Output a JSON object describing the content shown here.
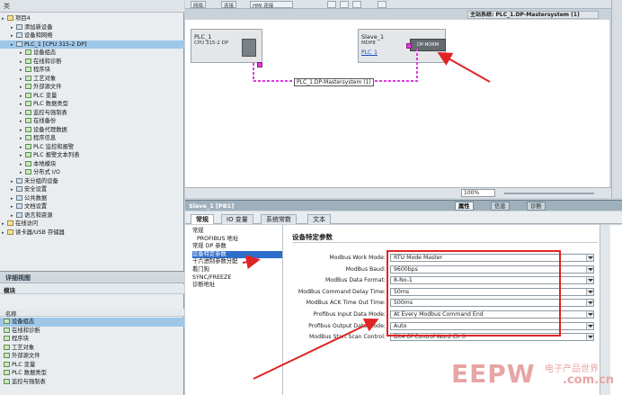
{
  "tree": {
    "header": "类",
    "items": [
      {
        "label": "项目4",
        "level": 0,
        "icon": "project-icon"
      },
      {
        "label": "添加新设备",
        "level": 1,
        "icon": "add-device-icon"
      },
      {
        "label": "设备和网络",
        "level": 1,
        "icon": "network-icon"
      },
      {
        "label": "PLC_1 [CPU 315-2 DP]",
        "level": 1,
        "icon": "plc-icon",
        "selected": true
      },
      {
        "label": "设备组态",
        "level": 2,
        "icon": "device-config-icon"
      },
      {
        "label": "在线和诊断",
        "level": 2,
        "icon": "online-diagnostics-icon"
      },
      {
        "label": "程序块",
        "level": 2,
        "icon": "program-blocks-icon"
      },
      {
        "label": "工艺对象",
        "level": 2,
        "icon": "technology-objects-icon"
      },
      {
        "label": "外部源文件",
        "level": 2,
        "icon": "external-source-icon"
      },
      {
        "label": "PLC 变量",
        "level": 2,
        "icon": "plc-tags-icon"
      },
      {
        "label": "PLC 数据类型",
        "level": 2,
        "icon": "plc-datatypes-icon"
      },
      {
        "label": "监控与强制表",
        "level": 2,
        "icon": "watch-table-icon"
      },
      {
        "label": "在线备份",
        "level": 2,
        "icon": "online-backup-icon"
      },
      {
        "label": "设备代理数据",
        "level": 2,
        "icon": "device-proxy-icon"
      },
      {
        "label": "程序信息",
        "level": 2,
        "icon": "program-info-icon"
      },
      {
        "label": "PLC 监控和报警",
        "level": 2,
        "icon": "plc-alarm-icon"
      },
      {
        "label": "PLC 报警文本列表",
        "level": 2,
        "icon": "alarm-text-icon"
      },
      {
        "label": "本地模块",
        "level": 2,
        "icon": "local-modules-icon"
      },
      {
        "label": "分布式 I/O",
        "level": 2,
        "icon": "distributed-io-icon"
      },
      {
        "label": "未分组的设备",
        "level": 1,
        "icon": "ungrouped-devices-icon"
      },
      {
        "label": "安全设置",
        "level": 1,
        "icon": "security-settings-icon"
      },
      {
        "label": "公共数据",
        "level": 1,
        "icon": "common-data-icon"
      },
      {
        "label": "文档设置",
        "level": 1,
        "icon": "document-settings-icon"
      },
      {
        "label": "语言和资源",
        "level": 1,
        "icon": "languages-icon"
      },
      {
        "label": "在线访问",
        "level": 0,
        "icon": "online-access-icon"
      },
      {
        "label": "读卡器/USB 存储器",
        "level": 0,
        "icon": "card-reader-icon"
      }
    ]
  },
  "detail": {
    "title": "详细视图",
    "subtitle": "模块",
    "column": "名称",
    "items": [
      {
        "label": "设备组态",
        "selected": true
      },
      {
        "label": "在线和诊断"
      },
      {
        "label": "程序块"
      },
      {
        "label": "工艺对象"
      },
      {
        "label": "外部源文件"
      },
      {
        "label": "PLC 变量"
      },
      {
        "label": "PLC 数据类型"
      },
      {
        "label": "监控与强制表"
      }
    ]
  },
  "network": {
    "toolbar": {
      "network_btn": "网络",
      "connect_btn": "连接",
      "hmi_conn": "HMI 连接"
    },
    "master_system": "主站系统: PLC_1.DP-Mastersystem (1)",
    "plc": {
      "name": "PLC_1",
      "type": "CPU 315-2 DP"
    },
    "slave": {
      "name": "Slave_1",
      "type": "MDP8",
      "link": "PLC_1",
      "module": "DP-NORM"
    },
    "bus_label": "PLC_1.DP-Mastersystem (1)",
    "zoom": "100%"
  },
  "properties": {
    "object": "Slave_1 [PB1]",
    "tabs": [
      "属性",
      "信息",
      "诊断"
    ],
    "sub_tabs": [
      "常规",
      "IO 变量",
      "系统常数",
      "文本"
    ],
    "nav": [
      {
        "label": "常规",
        "indent": false
      },
      {
        "label": "PROFIBUS 地址",
        "indent": true
      },
      {
        "label": "常规 DP 参数",
        "indent": false
      },
      {
        "label": "设备特定参数",
        "indent": false,
        "selected": true
      },
      {
        "label": "十六进制参数分配",
        "indent": false
      },
      {
        "label": "看门狗",
        "indent": false
      },
      {
        "label": "SYNC/FREEZE",
        "indent": false
      },
      {
        "label": "诊断地址",
        "indent": false
      }
    ],
    "section_title": "设备特定参数",
    "params": [
      {
        "label": "Modbus Work Mode:",
        "value": "RTU Mode Master"
      },
      {
        "label": "ModBus Baud:",
        "value": "9600bps"
      },
      {
        "label": "ModBus Data Format:",
        "value": "8-No-1"
      },
      {
        "label": "ModBus Command Delay Time:",
        "value": "50ms"
      },
      {
        "label": "ModBus ACK Time Out Time:",
        "value": "500ms"
      },
      {
        "label": "Profibus Input Data Mode:",
        "value": "At Every Modbus Command End"
      },
      {
        "label": "Profibus Output Data Mode:",
        "value": "Auto"
      },
      {
        "label": "ModBus Start Scan Control:",
        "value": "Bit4 Of Control Word Clr 0"
      }
    ]
  },
  "watermark": {
    "brand": "EEPW",
    "tagline": "电子产品世界",
    "domain": ".com.cn"
  },
  "colors": {
    "annotation": "#e02424",
    "bus": "#e03adf",
    "selection": "#2e6fc9"
  }
}
